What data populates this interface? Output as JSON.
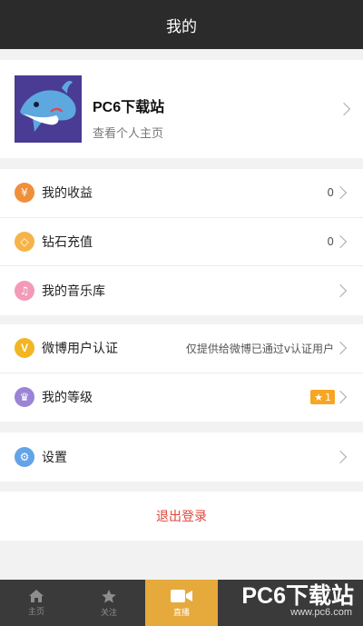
{
  "header": {
    "title": "我的"
  },
  "profile": {
    "name": "PC6下载站",
    "subtitle": "查看个人主页"
  },
  "group1": [
    {
      "label": "我的收益",
      "value": "0",
      "icon": "yen-icon",
      "color": "#f08f3a",
      "glyph": "¥"
    },
    {
      "label": "钻石充值",
      "value": "0",
      "icon": "diamond-icon",
      "color": "#f5b44a",
      "glyph": "◇"
    },
    {
      "label": "我的音乐库",
      "value": "",
      "icon": "music-icon",
      "color": "#f39ab8",
      "glyph": "♫"
    }
  ],
  "group2": [
    {
      "label": "微博用户认证",
      "value": "仅提供给微博已通过v认证用户",
      "icon": "verified-v-icon",
      "color": "#f2b524",
      "glyph": "V"
    },
    {
      "label": "我的等级",
      "value": "",
      "icon": "crown-icon",
      "color": "#9b84d6",
      "glyph": "♛",
      "badge": "1"
    }
  ],
  "group3": [
    {
      "label": "设置",
      "value": "",
      "icon": "settings-icon",
      "color": "#63a3e8",
      "glyph": "⚙"
    }
  ],
  "logout": {
    "label": "退出登录"
  },
  "tabbar": {
    "items": [
      {
        "label": "主页",
        "icon": "home-icon"
      },
      {
        "label": "关注",
        "icon": "star-icon"
      },
      {
        "label": "直播",
        "icon": "video-camera-icon",
        "active": true
      }
    ]
  },
  "watermark": {
    "text": "PC6下载站",
    "url": "www.pc6.com"
  },
  "colors": {
    "header": "#2b2b2b",
    "accent": "#e6a93c",
    "logout": "#e0443a"
  }
}
